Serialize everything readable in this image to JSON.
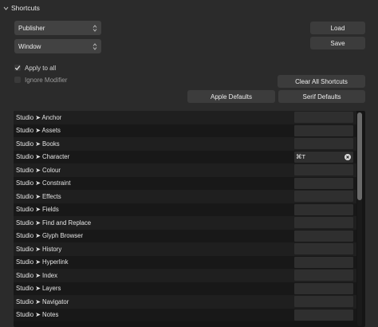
{
  "section": {
    "title": "Shortcuts"
  },
  "dropdowns": {
    "app": "Publisher",
    "category": "Window"
  },
  "buttons": {
    "load": "Load",
    "save": "Save",
    "clear_all": "Clear All Shortcuts",
    "apple_defaults": "Apple Defaults",
    "serif_defaults": "Serif Defaults"
  },
  "options": {
    "apply_to_all": {
      "label": "Apply to all",
      "checked": true
    },
    "ignore_modifier": {
      "label": "Ignore Modifier",
      "checked": false
    }
  },
  "shortcuts": [
    {
      "name": "Studio ➤ Anchor",
      "key": ""
    },
    {
      "name": "Studio ➤ Assets",
      "key": ""
    },
    {
      "name": "Studio ➤ Books",
      "key": ""
    },
    {
      "name": "Studio ➤ Character",
      "key": "⌘T"
    },
    {
      "name": "Studio ➤ Colour",
      "key": ""
    },
    {
      "name": "Studio ➤ Constraint",
      "key": ""
    },
    {
      "name": "Studio ➤ Effects",
      "key": ""
    },
    {
      "name": "Studio ➤ Fields",
      "key": ""
    },
    {
      "name": "Studio ➤ Find and Replace",
      "key": ""
    },
    {
      "name": "Studio ➤ Glyph Browser",
      "key": ""
    },
    {
      "name": "Studio ➤ History",
      "key": ""
    },
    {
      "name": "Studio ➤ Hyperlink",
      "key": ""
    },
    {
      "name": "Studio ➤ Index",
      "key": ""
    },
    {
      "name": "Studio ➤ Layers",
      "key": ""
    },
    {
      "name": "Studio ➤ Navigator",
      "key": ""
    },
    {
      "name": "Studio ➤ Notes",
      "key": ""
    }
  ],
  "icons": {
    "chevron": "chevron-down-icon",
    "check": "checkmark-icon",
    "clear": "clear-icon"
  }
}
